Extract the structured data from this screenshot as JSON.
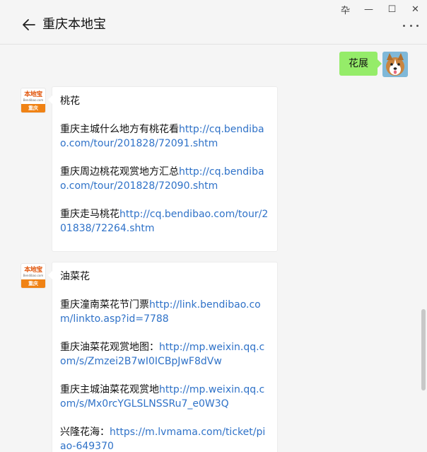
{
  "window": {
    "title": "重庆本地宝",
    "controls": {
      "pin": "卆",
      "minimize": "—",
      "maximize": "☐",
      "close": "✕"
    }
  },
  "messages": {
    "sent": {
      "text": "花展"
    },
    "bot_avatar": {
      "logo_text": "本地宝",
      "logo_sub": "Bendibao.com",
      "city": "重庆"
    },
    "msg1": {
      "heading": "桃花",
      "items": [
        {
          "text": "重庆主城什么地方有桃花看",
          "link": "http://cq.bendibao.com/tour/201828/72091.shtm"
        },
        {
          "text": "重庆周边桃花观赏地方汇总",
          "link": "http://cq.bendibao.com/tour/201828/72090.shtm"
        },
        {
          "text": "重庆走马桃花",
          "link": "http://cq.bendibao.com/tour/201838/72264.shtm"
        }
      ]
    },
    "msg2": {
      "heading": "油菜花",
      "items": [
        {
          "text": "重庆潼南菜花节门票",
          "link": "http://link.bendibao.com/linkto.asp?id=7788"
        },
        {
          "text": "重庆油菜花观赏地图：",
          "link": "http://mp.weixin.qq.com/s/Zmzei2B7wI0ICBpJwF8dVw"
        },
        {
          "text": "重庆主城油菜花观赏地",
          "link": "http://mp.weixin.qq.com/s/Mx0rcYGLSLNSSRu7_e0W3Q"
        },
        {
          "text": "兴隆花海：",
          "link": "https://m.lvmama.com/ticket/piao-649370"
        }
      ]
    }
  }
}
